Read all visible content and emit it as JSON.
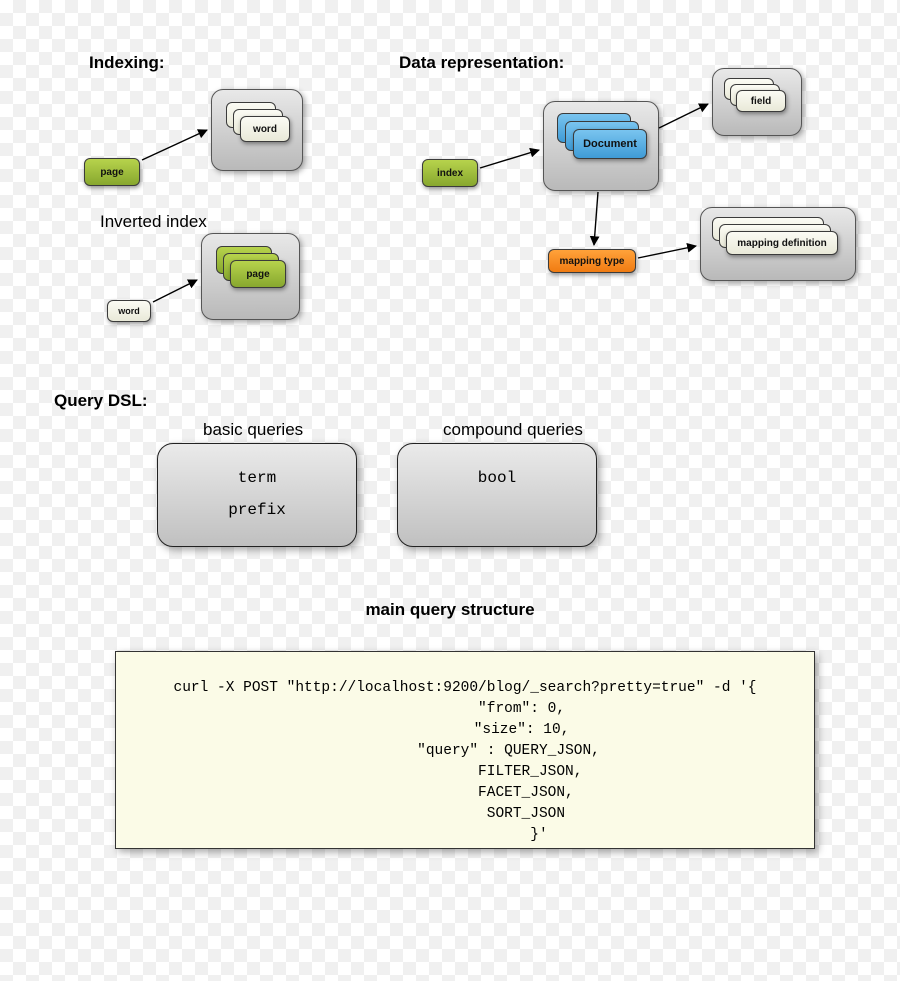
{
  "headings": {
    "indexing": "Indexing:",
    "inverted": "Inverted index",
    "data_rep": "Data representation:",
    "query_dsl": "Query DSL:",
    "basic_q": "basic queries",
    "compound_q": "compound queries",
    "main_qs": "main query structure"
  },
  "nodes": {
    "page": "page",
    "word": "word",
    "page_stack": "page",
    "word_small": "word",
    "index": "index",
    "document": "Document",
    "field": "field",
    "mapping_type": "mapping type",
    "mapping_def": "mapping definition"
  },
  "panels": {
    "basic_lines": [
      "term",
      "prefix"
    ],
    "compound_lines": [
      "bool"
    ]
  },
  "code": "curl -X POST \"http://localhost:9200/blog/_search?pretty=true\" -d '{\n             \"from\": 0,\n             \"size\": 10,\n          \"query\" : QUERY_JSON,\n               FILTER_JSON,\n              FACET_JSON,\n              SORT_JSON\n                 }'"
}
